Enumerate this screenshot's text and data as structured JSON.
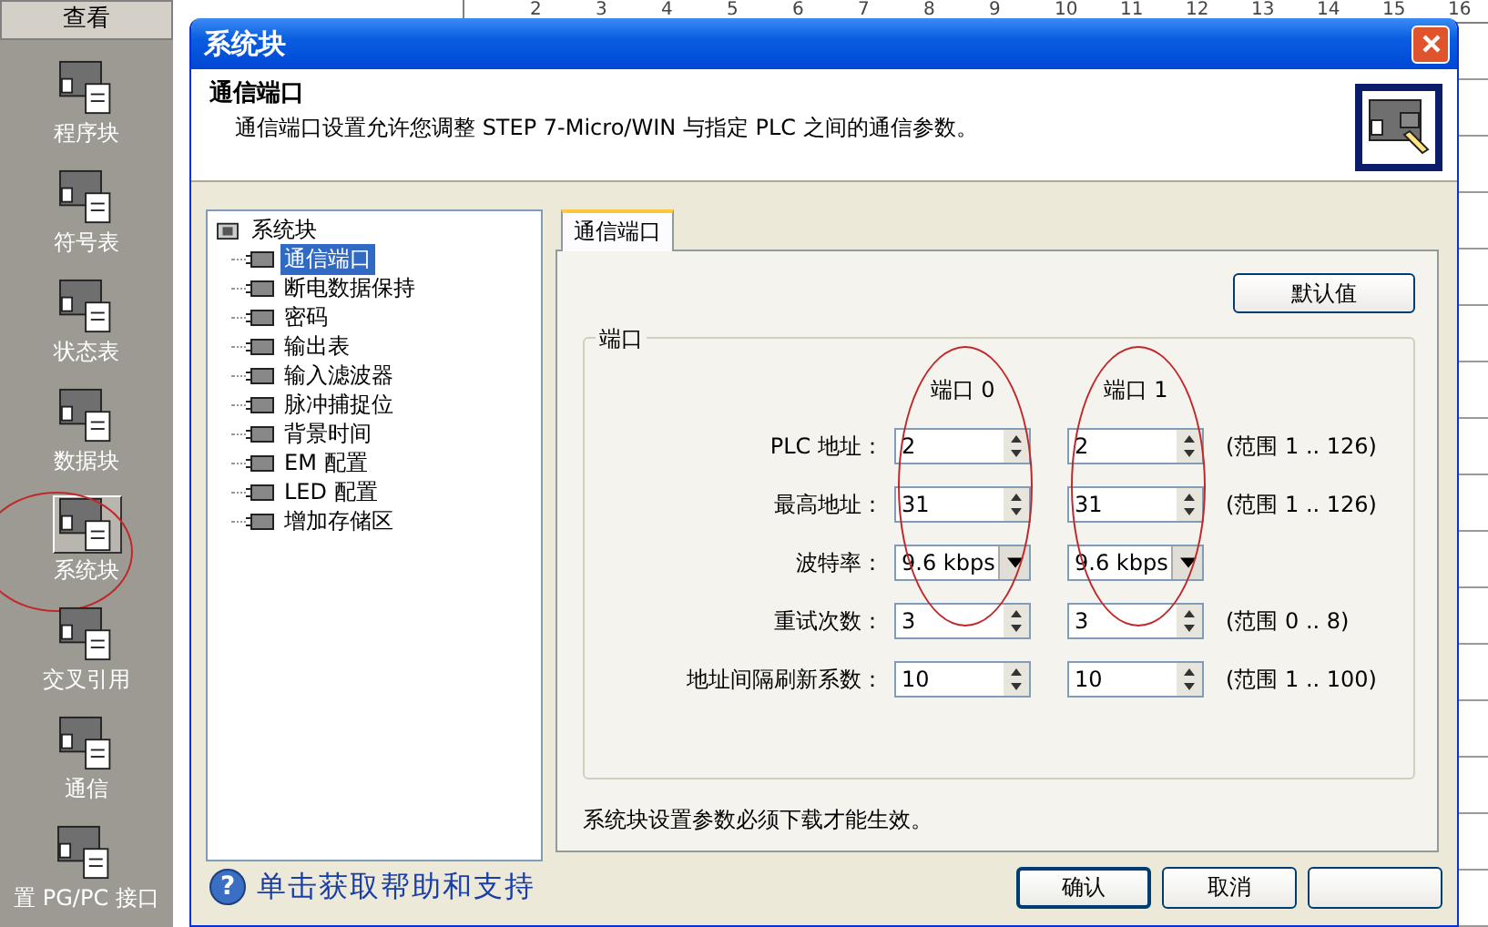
{
  "sidebar": {
    "header": "查看",
    "items": [
      {
        "label": "程序块",
        "selected": false,
        "circled": false
      },
      {
        "label": "符号表",
        "selected": false,
        "circled": false
      },
      {
        "label": "状态表",
        "selected": false,
        "circled": false
      },
      {
        "label": "数据块",
        "selected": false,
        "circled": false
      },
      {
        "label": "系统块",
        "selected": true,
        "circled": true
      },
      {
        "label": "交叉引用",
        "selected": false,
        "circled": false
      },
      {
        "label": "通信",
        "selected": false,
        "circled": false
      },
      {
        "label": "置 PG/PC 接口",
        "selected": false,
        "circled": false
      }
    ]
  },
  "background": {
    "ruler": [
      "2",
      "3",
      "4",
      "5",
      "6",
      "7",
      "8",
      "9",
      "10",
      "11",
      "12",
      "13",
      "14",
      "15",
      "16"
    ]
  },
  "dialog": {
    "title": "系统块",
    "heading": "通信端口",
    "description": "通信端口设置允许您调整 STEP 7-Micro/WIN 与指定 PLC 之间的通信参数。",
    "tree": {
      "root": "系统块",
      "children": [
        {
          "label": "通信端口",
          "selected": true
        },
        {
          "label": "断电数据保持",
          "selected": false
        },
        {
          "label": "密码",
          "selected": false
        },
        {
          "label": "输出表",
          "selected": false
        },
        {
          "label": "输入滤波器",
          "selected": false
        },
        {
          "label": "脉冲捕捉位",
          "selected": false
        },
        {
          "label": "背景时间",
          "selected": false
        },
        {
          "label": "EM 配置",
          "selected": false
        },
        {
          "label": "LED 配置",
          "selected": false
        },
        {
          "label": "增加存储区",
          "selected": false
        }
      ]
    },
    "tabs": [
      {
        "label": "通信端口",
        "selected": true
      }
    ],
    "default_button": "默认值",
    "group": {
      "title": "端口",
      "ports": [
        {
          "label": "端口 0",
          "circled": true
        },
        {
          "label": "端口 1",
          "circled": true
        }
      ],
      "rows": [
        {
          "kind": "spin",
          "label": "PLC 地址：",
          "values": [
            "2",
            "2"
          ],
          "range": "(范围 1 .. 126)"
        },
        {
          "kind": "spin",
          "label": "最高地址：",
          "values": [
            "31",
            "31"
          ],
          "range": "(范围 1 .. 126)"
        },
        {
          "kind": "dropdown",
          "label": "波特率：",
          "values": [
            "9.6 kbps",
            "9.6 kbps"
          ]
        },
        {
          "kind": "spin",
          "label": "重试次数：",
          "values": [
            "3",
            "3"
          ],
          "range": "(范围 0 .. 8)"
        },
        {
          "kind": "spin",
          "label": "地址间隔刷新系数：",
          "values": [
            "10",
            "10"
          ],
          "range": "(范围 1 .. 100)"
        }
      ]
    },
    "note": "系统块设置参数必须下载才能生效。",
    "help_icon": "?",
    "help": "单击获取帮助和支持",
    "buttons": [
      "确认",
      "取消"
    ]
  }
}
